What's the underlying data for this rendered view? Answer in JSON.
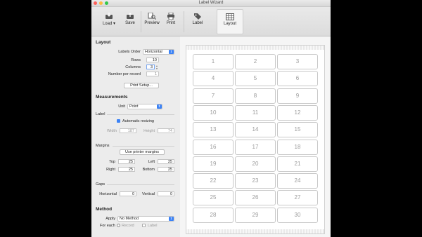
{
  "window": {
    "title": "Label Wizard"
  },
  "toolbar": {
    "load": "Load",
    "save": "Save",
    "preview": "Preview",
    "print": "Print",
    "label": "Label",
    "layout": "Layout"
  },
  "layout": {
    "heading": "Layout",
    "labels_order_label": "Labels Order",
    "labels_order_value": "Horizontal",
    "rows_label": "Rows",
    "rows_value": "10",
    "columns_label": "Columns",
    "columns_value": "3",
    "per_record_label": "Number per record",
    "per_record_value": "1",
    "print_setup": "Print Setup..."
  },
  "measurements": {
    "heading": "Measurements",
    "unit_label": "Unit",
    "unit_value": "Point",
    "label_section": "Label",
    "auto_resize": "Automatic resizing",
    "width_label": "Width",
    "width_value": "187",
    "height_label": "Height",
    "height_value": "74",
    "margins_section": "Margins",
    "use_printer_margins": "Use printer margins",
    "top_label": "Top",
    "top_value": "25",
    "left_label": "Left",
    "left_value": "25",
    "right_label": "Right",
    "right_value": "25",
    "bottom_label": "Bottom",
    "bottom_value": "25",
    "gaps_section": "Gaps",
    "horizontal_label": "Horizontal",
    "horizontal_value": "0",
    "vertical_label": "Vertical",
    "vertical_value": "0"
  },
  "method": {
    "heading": "Method",
    "apply_label": "Apply",
    "apply_value": "No Method",
    "for_each_label": "For each",
    "record": "Record",
    "label": "Label"
  },
  "preview": {
    "cells": [
      "1",
      "2",
      "3",
      "4",
      "5",
      "6",
      "7",
      "8",
      "9",
      "10",
      "11",
      "12",
      "13",
      "14",
      "15",
      "16",
      "17",
      "18",
      "19",
      "20",
      "21",
      "22",
      "23",
      "24",
      "25",
      "26",
      "27",
      "28",
      "29",
      "30"
    ]
  },
  "colors": {
    "accent": "#3b82f6",
    "close": "#fc605b",
    "minimize": "#fdbc40",
    "zoom": "#34c84a"
  }
}
